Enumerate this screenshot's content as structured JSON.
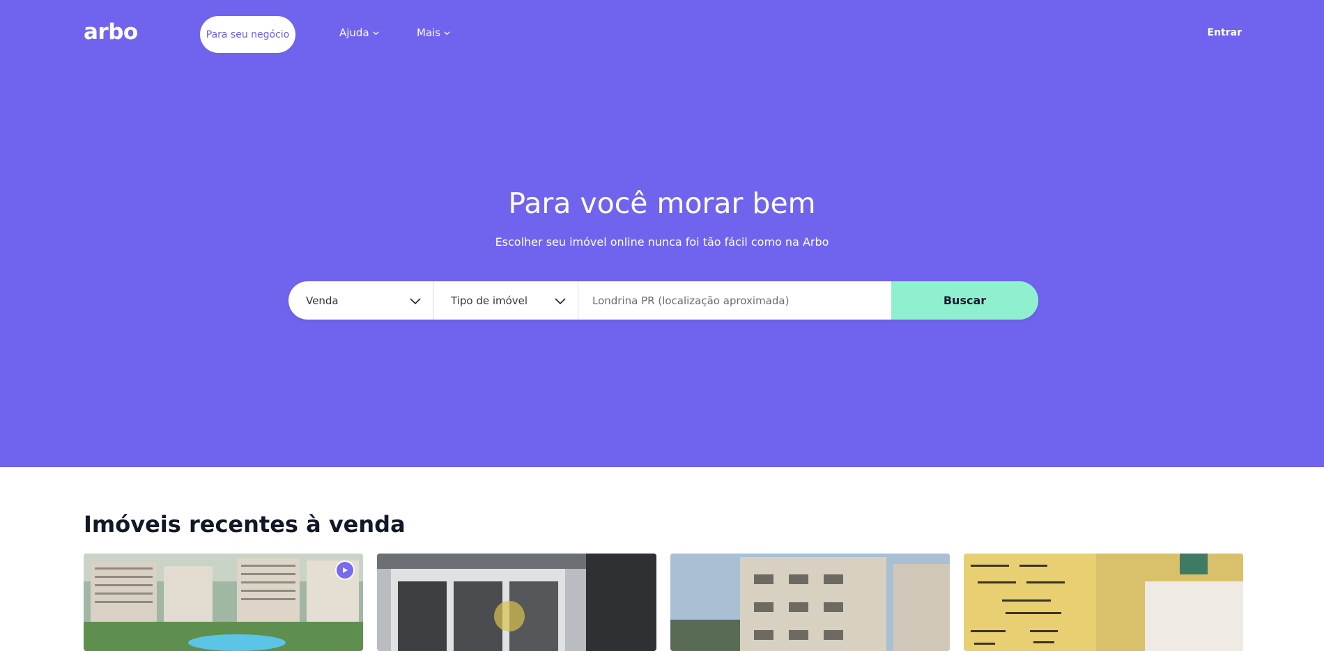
{
  "header": {
    "logo": "arbo",
    "business_btn": "Para seu negócio",
    "nav": [
      {
        "label": "Ajuda"
      },
      {
        "label": "Mais"
      }
    ],
    "login": "Entrar"
  },
  "hero": {
    "title": "Para você morar bem",
    "subtitle": "Escolher seu imóvel online nunca foi tão fácil como na Arbo",
    "search": {
      "transaction": "Venda",
      "property_type": "Tipo de imóvel",
      "location_placeholder": "Londrina PR (localização aproximada)",
      "button": "Buscar"
    }
  },
  "listings": {
    "title": "Imóveis recentes à venda"
  },
  "colors": {
    "hero_bg": "#7064ef",
    "accent_mint": "#8ff0cf",
    "play_badge": "#7a6af2"
  },
  "icons": [
    "chevron-down-icon",
    "play-icon"
  ]
}
